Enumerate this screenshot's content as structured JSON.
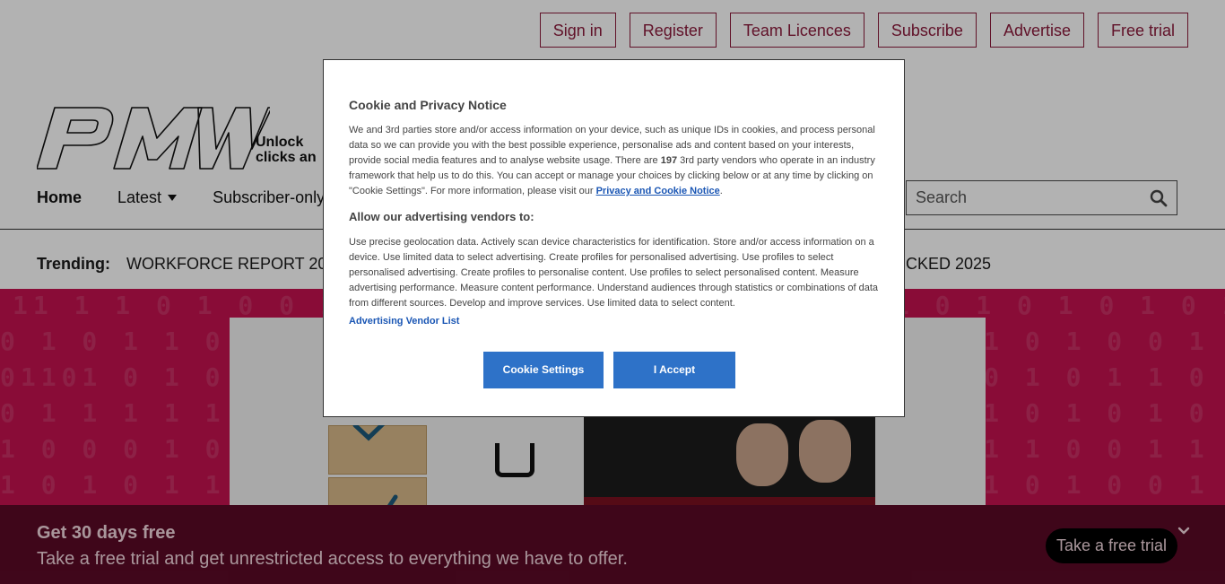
{
  "topbar": {
    "buttons": [
      "Sign in",
      "Register",
      "Team Licences",
      "Subscribe",
      "Advertise",
      "Free trial"
    ]
  },
  "logo": {
    "text": "PMW",
    "tagline_line1": "Unlock",
    "tagline_line2": "clicks an"
  },
  "nav": {
    "items": [
      {
        "label": "Home",
        "has_dropdown": false
      },
      {
        "label": "Latest",
        "has_dropdown": true
      },
      {
        "label": "Subscriber-only",
        "has_dropdown": true
      }
    ]
  },
  "search": {
    "placeholder": "Search",
    "icon": "search-icon"
  },
  "trending": {
    "label": "Trending:",
    "items": [
      "WORKFORCE REPORT 2024"
    ],
    "right_item": "CKED 2025"
  },
  "promo": {
    "title": "Get 30 days free",
    "subtitle": "Take a free trial and get unrestricted access to everything we have to offer.",
    "button": "Take a free trial",
    "collapse_icon": "chevron-down-icon"
  },
  "cookie_dialog": {
    "title": "Cookie and Privacy Notice",
    "body_prefix": "We and 3rd parties store and/or access information on your device, such as unique IDs in cookies, and process personal data so we can provide you with the best possible experience, personalise ads and content based on your interests, provide social media features and to analyse website usage. There are ",
    "vendor_count": "197",
    "body_suffix": " 3rd party vendors who operate in an industry framework that help us to do this. You can accept or manage your choices by clicking below or at any time by clicking on \"Cookie Settings\". For more information, please visit our ",
    "privacy_link": "Privacy and Cookie Notice",
    "subtitle": "Allow our advertising vendors to:",
    "vendor_text": "Use precise geolocation data. Actively scan device characteristics for identification. Store and/or access information on a device. Use limited data to select advertising. Create profiles for personalised advertising. Use profiles to select personalised advertising. Create profiles to personalise content. Use profiles to select personalised content. Measure advertising performance. Measure content performance. Understand audiences through statistics or combinations of data from different sources. Develop and improve services. Use limited data to select content.",
    "vendor_list_link": "Advertising Vendor List",
    "settings_button": "Cookie Settings",
    "accept_button": "I Accept"
  },
  "colors": {
    "brand": "#8b1a3c",
    "hero_bg": "#c4124f",
    "promo_bg": "#5b0a26",
    "dialog_button": "#2e72c8"
  }
}
